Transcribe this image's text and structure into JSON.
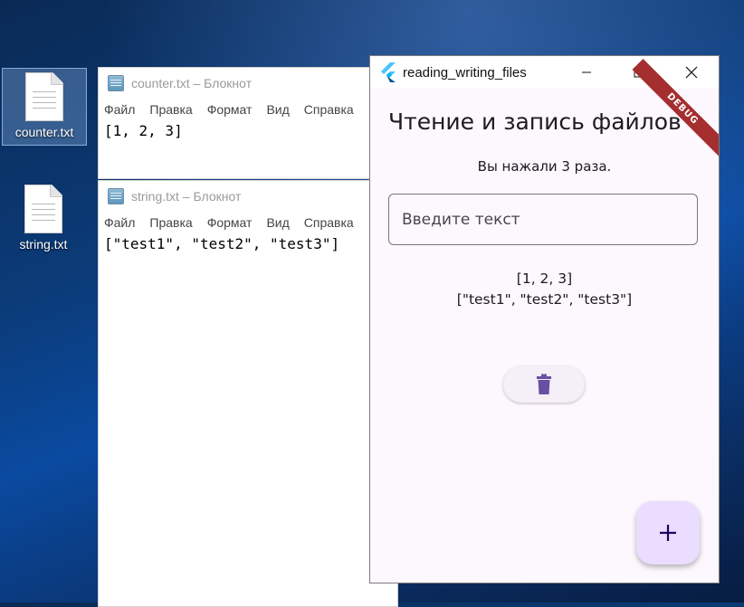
{
  "desktop": {
    "icons": [
      {
        "label": "counter.txt"
      },
      {
        "label": "string.txt"
      }
    ]
  },
  "notepad_counter": {
    "title": "counter.txt – Блокнот",
    "menu": [
      "Файл",
      "Правка",
      "Формат",
      "Вид",
      "Справка"
    ],
    "content": "[1, 2, 3]"
  },
  "notepad_string": {
    "title": "string.txt – Блокнот",
    "menu": [
      "Файл",
      "Правка",
      "Формат",
      "Вид",
      "Справка"
    ],
    "content": "[\"test1\", \"test2\", \"test3\"]"
  },
  "app": {
    "window_title": "reading_writing_files",
    "debug_banner": "DEBUG",
    "heading": "Чтение и запись файлов",
    "press_text": "Вы нажали 3 раза.",
    "input_placeholder": "Введите текст",
    "counter_line": "[1, 2, 3]",
    "strings_line": "[\"test1\", \"test2\", \"test3\"]",
    "fab_label": "+",
    "icons": {
      "delete": "trash-icon",
      "logo": "flutter-logo-icon",
      "minimize": "minimize-icon",
      "maximize": "maximize-icon",
      "close": "close-icon"
    },
    "colors": {
      "background": "#fdf7fe",
      "primary": "#6750a4",
      "fab": "#eaddff",
      "debug": "#a52e2e"
    }
  }
}
